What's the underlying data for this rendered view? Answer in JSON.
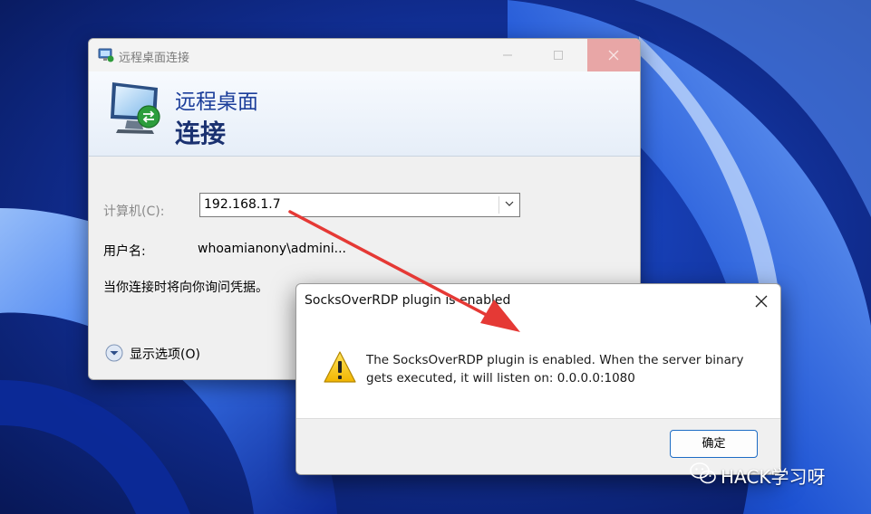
{
  "rdp_window": {
    "title": "远程桌面连接",
    "banner_line1": "远程桌面",
    "banner_line2": "连接",
    "computer_label": "计算机(C):",
    "computer_value": "192.168.1.7",
    "username_label": "用户名:",
    "username_value": "whoamianony\\admini...",
    "credential_hint": "当你连接时将向你询问凭据。",
    "show_options_label": "显示选项(O)"
  },
  "dialog": {
    "title": "SocksOverRDP plugin is enabled",
    "message_line1": "The SocksOverRDP plugin is enabled. When the server binary",
    "message_line2": "gets executed, it will listen on: 0.0.0.0:1080",
    "ok_label": "确定",
    "icon": "warning-icon"
  },
  "watermark": {
    "text": "HACK学习呀",
    "icon": "wechat-icon"
  },
  "colors": {
    "wallpaper_dark": "#0b1f6e",
    "wallpaper_ribbon": "#2f6ef0",
    "annotation_arrow": "#e53935",
    "banner_text": "#1b3d9a",
    "ok_border": "#1d6cc4"
  }
}
